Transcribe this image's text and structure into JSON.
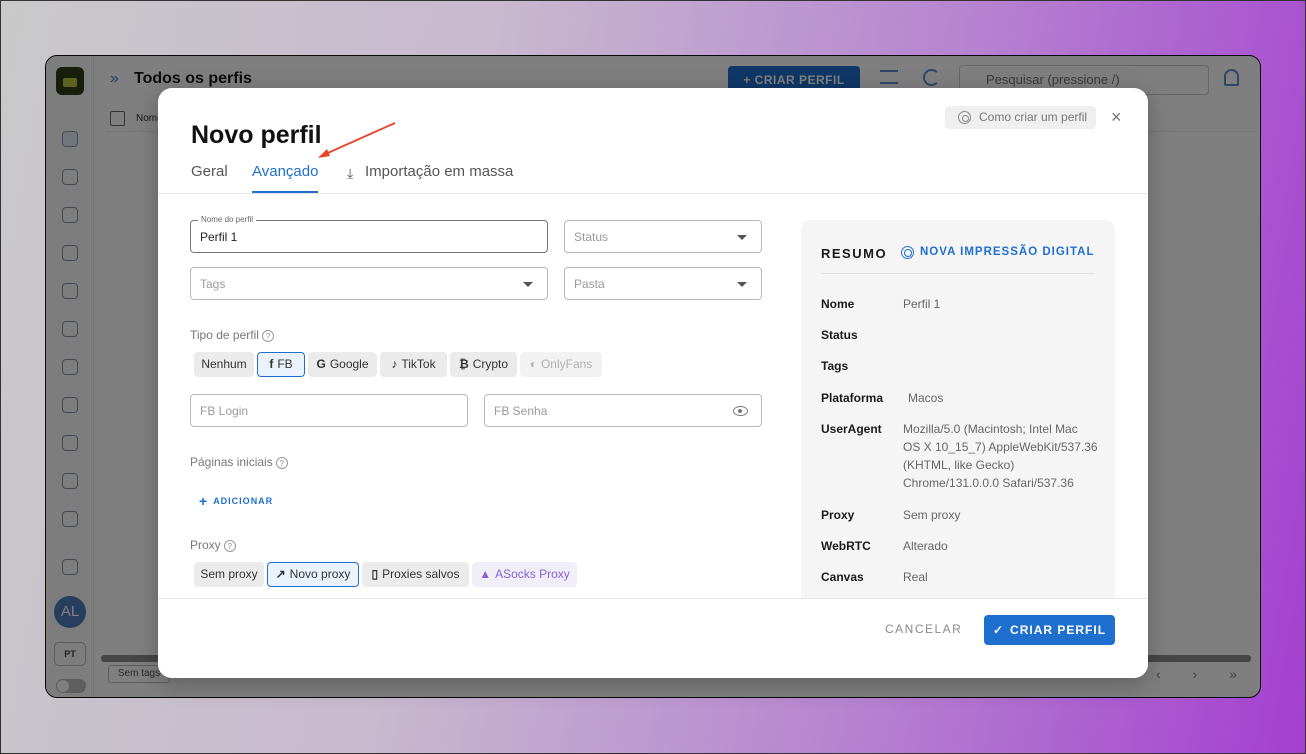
{
  "app": {
    "title": "Todos os perfis",
    "create_button": "+ CRIAR PERFIL",
    "search_placeholder": "Pesquisar (pressione /)",
    "table_col_name": "Nome",
    "avatar_initials": "AL",
    "language": "PT",
    "tags_button": "Sem tags"
  },
  "modal": {
    "title": "Novo perfil",
    "help_button": "Como criar um perfil",
    "close_glyph": "×",
    "tabs": [
      {
        "label": "Geral",
        "active": false
      },
      {
        "label": "Avançado",
        "active": true
      },
      {
        "label": "Importação em massa",
        "active": false
      }
    ],
    "download_glyph": "⤓",
    "fields": {
      "profile_name_label": "Nome do perfil",
      "profile_name_value": "Perfil 1",
      "status_placeholder": "Status",
      "tags_placeholder": "Tags",
      "folder_placeholder": "Pasta",
      "fb_login_placeholder": "FB Login",
      "fb_password_placeholder": "FB Senha"
    },
    "profile_type": {
      "label": "Tipo de perfil",
      "options": [
        {
          "label": "Nenhum",
          "icon": ""
        },
        {
          "label": "FB",
          "icon": "f"
        },
        {
          "label": "Google",
          "icon": "G"
        },
        {
          "label": "TikTok",
          "icon": "♪"
        },
        {
          "label": "Crypto",
          "icon": "₿"
        },
        {
          "label": "OnlyFans",
          "icon": "◐"
        }
      ],
      "selected": "FB"
    },
    "start_pages": {
      "label": "Páginas iniciais",
      "add_button": "ADICIONAR"
    },
    "proxy": {
      "label": "Proxy",
      "options": [
        {
          "label": "Sem proxy",
          "icon": ""
        },
        {
          "label": "Novo proxy",
          "icon": "↗"
        },
        {
          "label": "Proxies salvos",
          "icon": "▯"
        },
        {
          "label": "ASocks Proxy",
          "icon": "▲"
        }
      ],
      "selected": "Novo proxy"
    },
    "summary": {
      "title": "RESUMO",
      "fingerprint_button": "NOVA IMPRESSÃO DIGITAL",
      "rows": [
        {
          "label": "Nome",
          "value": "Perfil 1"
        },
        {
          "label": "Status",
          "value": ""
        },
        {
          "label": "Tags",
          "value": ""
        },
        {
          "label": "Plataforma",
          "value": "Macos"
        },
        {
          "label": "UserAgent",
          "value": "Mozilla/5.0 (Macintosh; Intel Mac OS X 10_15_7) AppleWebKit/537.36 (KHTML, like Gecko) Chrome/131.0.0.0 Safari/537.36"
        },
        {
          "label": "Proxy",
          "value": "Sem proxy"
        },
        {
          "label": "WebRTC",
          "value": "Alterado"
        },
        {
          "label": "Canvas",
          "value": "Real"
        }
      ]
    },
    "footer": {
      "cancel": "CANCELAR",
      "create": "CRIAR PERFIL"
    }
  },
  "colors": {
    "accent": "#1f6fcf",
    "annotation_arrow": "#e8432a",
    "asocks": "#8863d8"
  }
}
